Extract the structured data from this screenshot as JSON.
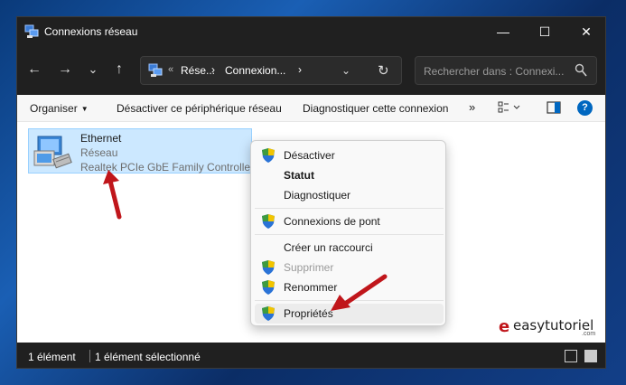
{
  "window": {
    "title": "Connexions réseau",
    "controls": {
      "minimize": "—",
      "maximize": "☐",
      "close": "✕"
    }
  },
  "nav": {
    "back": "←",
    "forward": "→",
    "recent": "⌄",
    "up": "↑",
    "address": {
      "chevron": "«",
      "segments": [
        "Rése...",
        "Connexion..."
      ],
      "separator": "›",
      "dropdown": "⌄",
      "refresh": "↻"
    },
    "search": {
      "placeholder": "Rechercher dans : Connexi..."
    }
  },
  "commandbar": {
    "organize": "Organiser",
    "disable": "Désactiver ce périphérique réseau",
    "diagnose": "Diagnostiquer cette connexion",
    "more": "»",
    "help": "?"
  },
  "item": {
    "name": "Ethernet",
    "line2": "Réseau",
    "line3": "Realtek PCIe GbE Family Controller"
  },
  "context_menu": {
    "items": [
      {
        "label": "Désactiver",
        "shield": true
      },
      {
        "label": "Statut",
        "bold": true
      },
      {
        "label": "Diagnostiquer"
      },
      {
        "label": "Connexions de pont",
        "shield": true
      },
      {
        "label": "Créer un raccourci"
      },
      {
        "label": "Supprimer",
        "shield": true,
        "disabled": true
      },
      {
        "label": "Renommer",
        "shield": true
      },
      {
        "label": "Propriétés",
        "shield": true,
        "highlighted": true
      }
    ]
  },
  "statusbar": {
    "count": "1 élément",
    "selected": "1 élément sélectionné"
  },
  "watermark": {
    "text": "easytutoriel",
    "suffix": ".com"
  },
  "colors": {
    "accent_arrow": "#c0161b",
    "selection": "#cce8ff",
    "titlebar": "#202020"
  }
}
